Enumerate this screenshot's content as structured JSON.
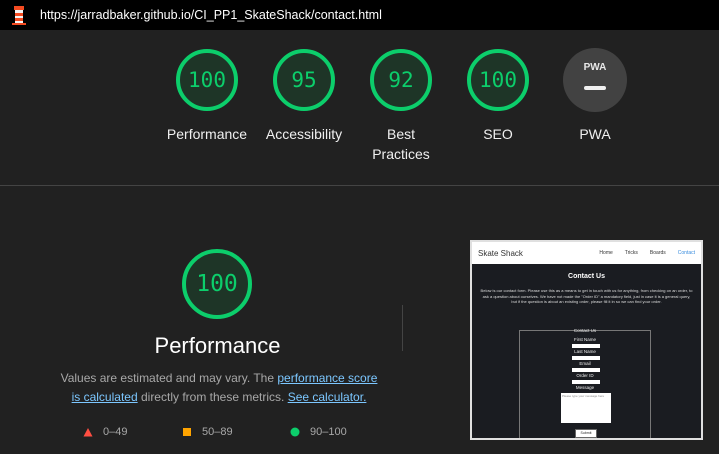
{
  "browser": {
    "url": "https://jarradbaker.github.io/CI_PP1_SkateShack/contact.html"
  },
  "scores": [
    {
      "label": "Performance",
      "value": "100",
      "kind": "score",
      "color": "#0cce6b"
    },
    {
      "label": "Accessibility",
      "value": "95",
      "kind": "score",
      "color": "#0cce6b"
    },
    {
      "label": "Best Practices",
      "value": "92",
      "kind": "score",
      "color": "#0cce6b"
    },
    {
      "label": "SEO",
      "value": "100",
      "kind": "score",
      "color": "#0cce6b"
    },
    {
      "label": "PWA",
      "value": "PWA",
      "kind": "pwa",
      "color": "#e8e8e8"
    }
  ],
  "performance": {
    "score": "100",
    "title": "Performance",
    "desc_prefix": "Values are estimated and may vary. The ",
    "link_score": "performance score",
    "link_calc": "is calculated",
    "desc_mid": " directly from these metrics. ",
    "link_calculator": "See calculator."
  },
  "legend": [
    {
      "label": "0–49",
      "shape": "triangle",
      "color": "#ff4e42"
    },
    {
      "label": "50–89",
      "shape": "square",
      "color": "#ffa400"
    },
    {
      "label": "90–100",
      "shape": "circle",
      "color": "#0cce6b"
    }
  ],
  "thumbnail": {
    "brand": "Skate Shack",
    "nav": [
      "Home",
      "Tricks",
      "Boards",
      "Contact"
    ],
    "heading": "Contact Us",
    "paragraph": "Below is our contact form. Please use this as a means to get in touch with us for anything, from checking on an order, to ask a question about ourselves. We have not made the \"Order ID\" a mandatory field, just in case it is a general query, but if the question is about an existing order, please fill it in so we can find your order.",
    "form_legend": "Contact Us",
    "fields": [
      "First Name",
      "Last Name",
      "Email",
      "Order ID",
      "Message"
    ],
    "message_placeholder": "Please type your message here",
    "submit": "Submit Form"
  }
}
